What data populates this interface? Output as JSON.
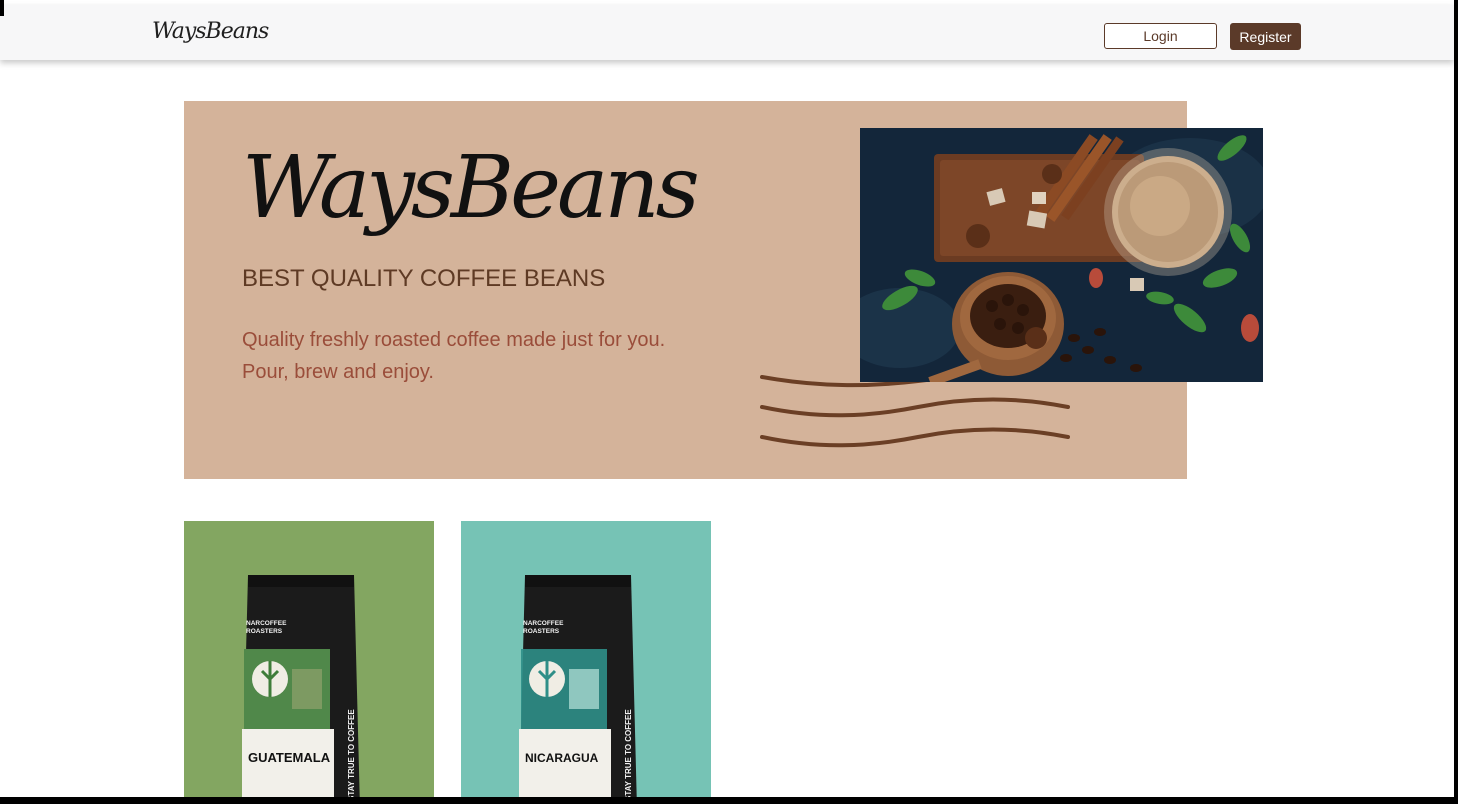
{
  "navbar": {
    "logo_text": "WaysBeans",
    "login_label": "Login",
    "register_label": "Register"
  },
  "hero": {
    "logo_text": "WaysBeans",
    "title": "BEST QUALITY COFFEE BEANS",
    "description_line1": "Quality freshly roasted coffee made just for you.",
    "description_line2": "Pour, brew and enjoy.",
    "image_icon": "coffee-spices-photo"
  },
  "products": [
    {
      "brand_line1": "NARCOFFEE",
      "brand_line2": "ROASTERS",
      "name": "GUATEMALA",
      "side_text": "STAY TRUE TO COFFEE",
      "bg_color": "#83a661",
      "accent_color": "#3f7d3a"
    },
    {
      "brand_line1": "NARCOFFEE",
      "brand_line2": "ROASTERS",
      "name": "NICARAGUA",
      "side_text": "STAY TRUE TO COFFEE",
      "bg_color": "#76c3b5",
      "accent_color": "#2f8f88"
    }
  ],
  "colors": {
    "brand_brown": "#5b3a29",
    "hero_bg": "#d4b39a"
  }
}
